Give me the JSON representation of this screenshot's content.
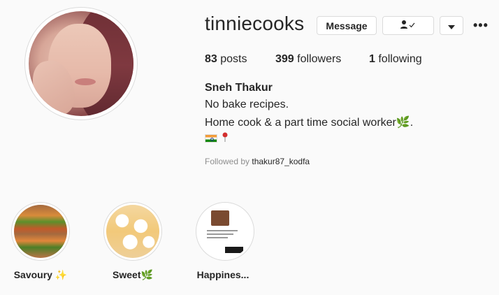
{
  "profile": {
    "username": "tinniecooks",
    "buttons": {
      "message": "Message",
      "follow_icon": "person-check-icon",
      "more_icon": "caret-down-icon",
      "options_icon": "ellipsis-icon"
    },
    "stats": {
      "posts_count": "83",
      "posts_label": "posts",
      "followers_count": "399",
      "followers_label": "followers",
      "following_count": "1",
      "following_label": "following"
    },
    "full_name": "Sneh Thakur",
    "bio": {
      "line1": "No bake recipes.",
      "line2": "Home cook & a part time social worker",
      "line2_emoji": "🌿",
      "line2_end": "."
    },
    "followed_by_prefix": "Followed by",
    "followed_by_user": "thakur87_kodfa"
  },
  "highlights": [
    {
      "title": "Savoury",
      "emoji": "✨"
    },
    {
      "title": "Sweet",
      "emoji": "🌿"
    },
    {
      "title": "Happines...",
      "emoji": ""
    }
  ]
}
